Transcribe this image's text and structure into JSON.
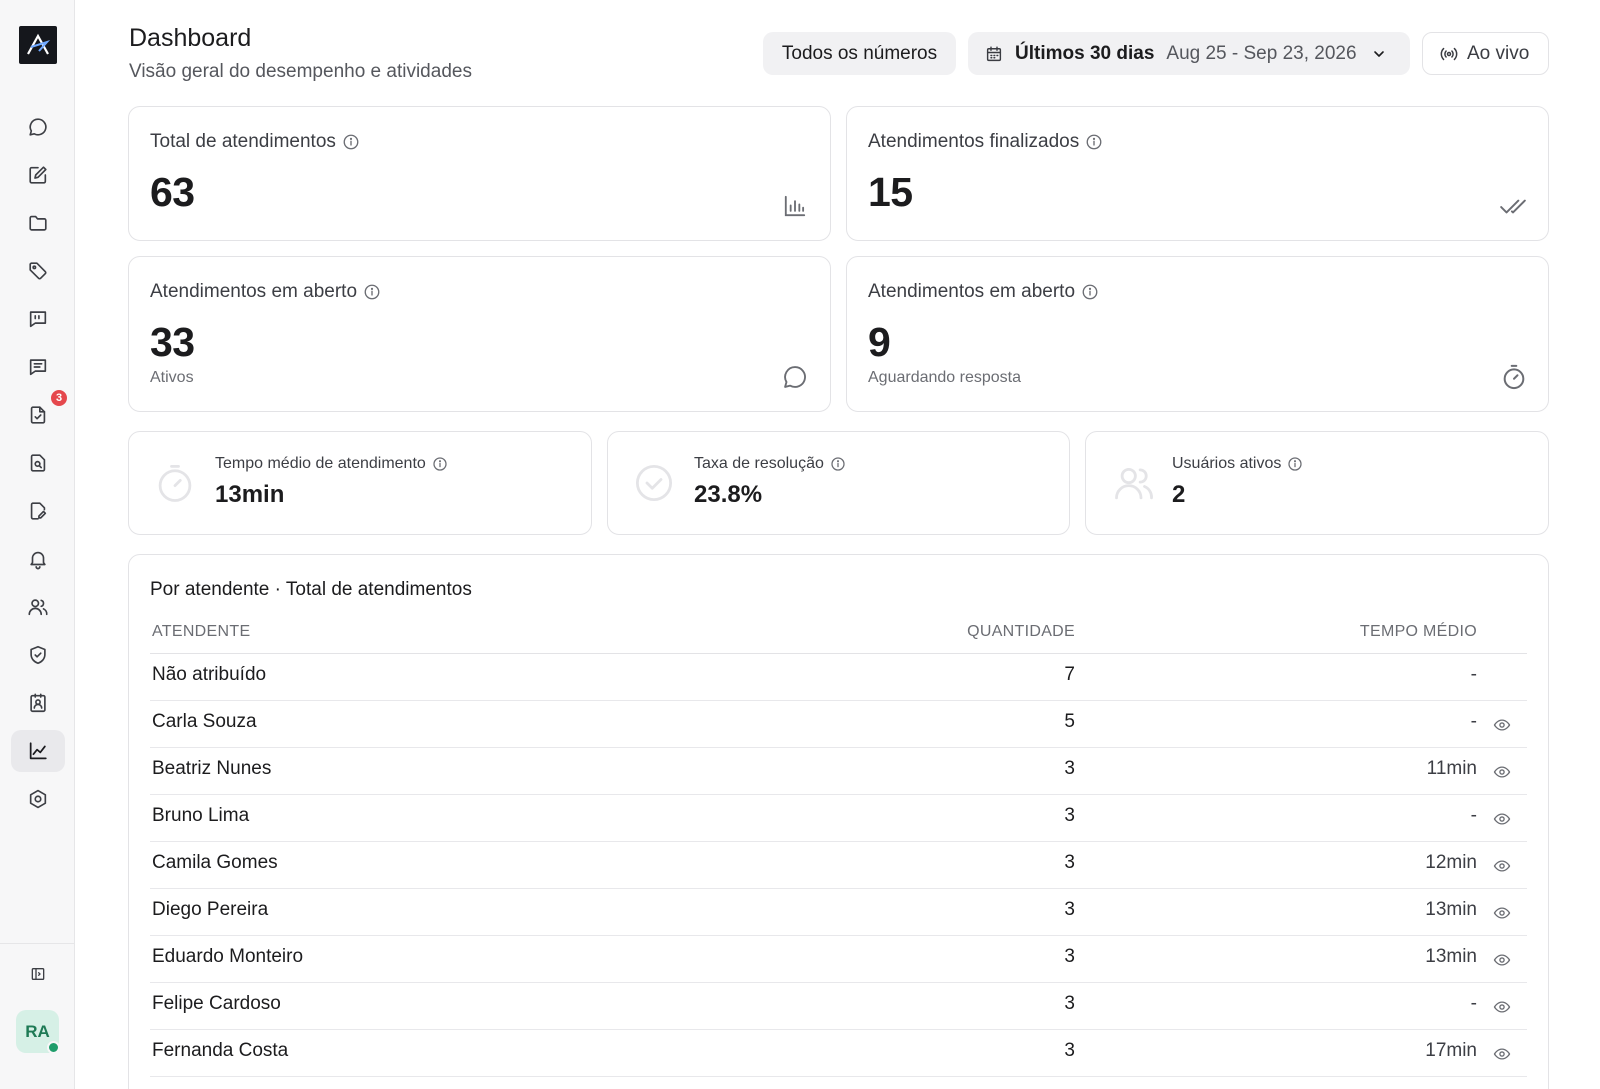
{
  "sidebar": {
    "logo_icon": "brand-logo",
    "items": [
      {
        "icon": "chat-bubble-icon",
        "active": false
      },
      {
        "icon": "edit-note-icon",
        "active": false
      },
      {
        "icon": "folder-icon",
        "active": false
      },
      {
        "icon": "tag-icon",
        "active": false
      },
      {
        "icon": "quote-message-icon",
        "active": false
      },
      {
        "icon": "message-lines-icon",
        "active": false
      },
      {
        "icon": "file-check-icon",
        "active": false,
        "badge": "3"
      },
      {
        "icon": "file-search-icon",
        "active": false
      },
      {
        "icon": "file-edit-icon",
        "active": false
      },
      {
        "icon": "bell-icon",
        "active": false
      },
      {
        "icon": "users-icon",
        "active": false
      },
      {
        "icon": "shield-check-icon",
        "active": false
      },
      {
        "icon": "contact-card-icon",
        "active": false
      },
      {
        "icon": "chart-line-icon",
        "active": true
      },
      {
        "icon": "settings-hex-icon",
        "active": false
      }
    ],
    "collapse_icon": "sidebar-toggle-icon",
    "user": {
      "initials": "RA",
      "status_color": "#1f9d6b"
    }
  },
  "header": {
    "title": "Dashboard",
    "subtitle": "Visão geral do desempenho e atividades",
    "filter_all": "Todos os números",
    "date_label": "Últimos 30 dias",
    "date_range": "Aug 25 - Sep 23, 2026",
    "live_label": "Ao vivo"
  },
  "stats": {
    "total": {
      "label": "Total de atendimentos",
      "value": "63",
      "icon": "bar-chart-icon"
    },
    "finished": {
      "label": "Atendimentos finalizados",
      "value": "15",
      "icon": "double-check-icon"
    },
    "open": {
      "label": "Atendimentos em aberto",
      "value": "33",
      "sub": "Ativos",
      "icon": "chat-bubble-icon"
    },
    "waiting": {
      "label": "Atendimentos em aberto",
      "value": "9",
      "sub": "Aguardando resposta",
      "icon": "timer-icon"
    }
  },
  "metrics": {
    "avg_time": {
      "label": "Tempo médio de atendimento",
      "value": "13min"
    },
    "resolution": {
      "label": "Taxa de resolução",
      "value": "23.8%"
    },
    "active_users": {
      "label": "Usuários ativos",
      "value": "2"
    }
  },
  "table": {
    "title": "Por atendente · Total de atendimentos",
    "columns": [
      "ATENDENTE",
      "QUANTIDADE",
      "TEMPO MÉDIO"
    ],
    "rows": [
      {
        "name": "Não atribuído",
        "qty": "7",
        "time": "-",
        "action": false
      },
      {
        "name": "Carla Souza",
        "qty": "5",
        "time": "-",
        "action": true
      },
      {
        "name": "Beatriz Nunes",
        "qty": "3",
        "time": "11min",
        "action": true
      },
      {
        "name": "Bruno Lima",
        "qty": "3",
        "time": "-",
        "action": true
      },
      {
        "name": "Camila Gomes",
        "qty": "3",
        "time": "12min",
        "action": true
      },
      {
        "name": "Diego Pereira",
        "qty": "3",
        "time": "13min",
        "action": true
      },
      {
        "name": "Eduardo Monteiro",
        "qty": "3",
        "time": "13min",
        "action": true
      },
      {
        "name": "Felipe Cardoso",
        "qty": "3",
        "time": "-",
        "action": true
      },
      {
        "name": "Fernanda Costa",
        "qty": "3",
        "time": "17min",
        "action": true
      }
    ]
  },
  "colors": {
    "badge": "#e5484d",
    "avatar_bg": "#d6f0e6",
    "avatar_text": "#1e7a55"
  }
}
